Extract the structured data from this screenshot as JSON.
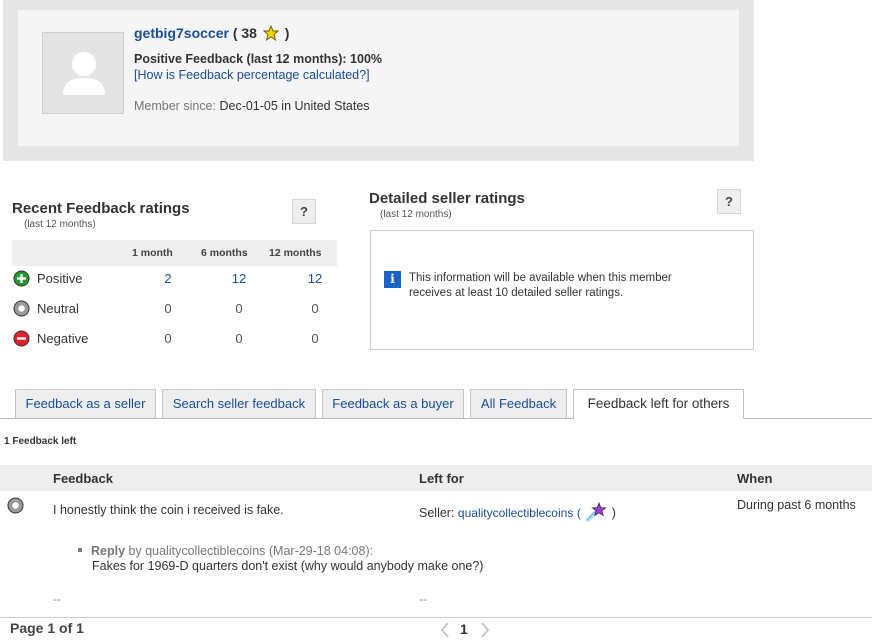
{
  "profile": {
    "username": "getbig7soccer",
    "score_open": "(",
    "score": "38",
    "score_close": ")",
    "positive_label": "Positive Feedback (last 12 months):",
    "positive_value": "100%",
    "how_link": "[How is Feedback percentage calculated?]",
    "member_since_label": "Member since:",
    "member_since_value": "Dec-01-05 in United States",
    "star_color": "#f5d400"
  },
  "recent": {
    "title": "Recent Feedback ratings",
    "subtitle": "(last 12 months)",
    "help": "?",
    "columns": [
      "1 month",
      "6 months",
      "12 months"
    ],
    "rows": [
      {
        "label": "Positive",
        "icon": "positive-icon",
        "values": [
          "2",
          "12",
          "12"
        ]
      },
      {
        "label": "Neutral",
        "icon": "neutral-icon",
        "values": [
          "0",
          "0",
          "0"
        ]
      },
      {
        "label": "Negative",
        "icon": "negative-icon",
        "values": [
          "0",
          "0",
          "0"
        ]
      }
    ]
  },
  "detailed": {
    "title": "Detailed seller ratings",
    "subtitle": "(last 12 months)",
    "help": "?",
    "info_icon": "i",
    "message": "This information will be available when this member receives at least 10 detailed seller ratings."
  },
  "tabs": [
    {
      "label": "Feedback as a seller",
      "active": false
    },
    {
      "label": "Search seller feedback",
      "active": false
    },
    {
      "label": "Feedback as a buyer",
      "active": false
    },
    {
      "label": "All Feedback",
      "active": false
    },
    {
      "label": "Feedback left for others",
      "active": true
    }
  ],
  "feedback_count": "1 Feedback left",
  "table": {
    "headers": {
      "feedback": "Feedback",
      "left_for": "Left for",
      "when": "When"
    },
    "rows": [
      {
        "text": "I honestly think the coin i received is fake.",
        "role_label": "Seller:",
        "user": "qualitycollectiblecoins",
        "paren_open": "(",
        "paren_close": ")",
        "when": "During past 6 months",
        "reply_label": "Reply",
        "reply_by": "by qualitycollectiblecoins (Mar-29-18 04:08):",
        "reply_text": "Fakes for 1969-D quarters don't exist (why would anybody make one?)",
        "dash1": "--",
        "dash2": "--"
      }
    ]
  },
  "pagination": {
    "label": "Page 1 of 1",
    "current": "1"
  }
}
